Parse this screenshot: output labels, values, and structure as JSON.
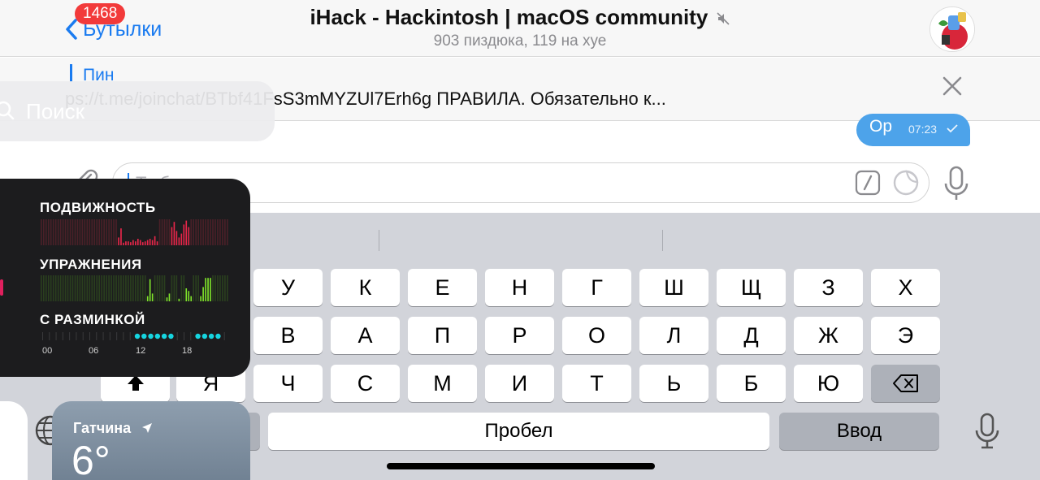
{
  "header": {
    "back_label": "Бутылки",
    "unread_badge": "1468",
    "title": "iHack - Hackintosh | macOS community",
    "subtitle": "903 пиздюка, 119 на хуе",
    "mute_icon": "speaker-muted-icon",
    "avatar_icon": "group-avatar"
  },
  "pinned": {
    "label": "Пин",
    "text": "ps://t.me/joinchat/BTbf41FsS3mMYZUl7Erh6g ПРАВИЛА. Обязательно к...",
    "close_icon": "close-icon"
  },
  "message": {
    "text": "Ор",
    "time": "07:23",
    "status_icon": "checkmark-icon"
  },
  "composer": {
    "placeholder": "Т...б...тут...",
    "attach_icon": "paperclip-icon",
    "command_icon": "slash-command-icon",
    "sticker_icon": "sticker-icon",
    "mic_icon": "microphone-icon"
  },
  "keyboard": {
    "row1": [
      "У",
      "К",
      "Е",
      "Н",
      "Г",
      "Ш",
      "Щ",
      "З",
      "Х"
    ],
    "row2": [
      "В",
      "А",
      "П",
      "Р",
      "О",
      "Л",
      "Д",
      "Ж",
      "Э"
    ],
    "row3": [
      "Я",
      "Ч",
      "С",
      "М",
      "И",
      "Т",
      "Ь",
      "Б",
      "Ю"
    ],
    "space_label": "Пробел",
    "return_label": "Ввод",
    "shift_icon": "shift-icon",
    "backspace_icon": "backspace-icon",
    "globe_icon": "globe-icon",
    "dictation_icon": "microphone-icon"
  },
  "search_overlay": {
    "label": "Поиск",
    "icon": "search-icon"
  },
  "activity": {
    "move_label": "ПОДВИЖНОСТЬ",
    "exercise_label": "УПРАЖНЕНИЯ",
    "stand_label": "С РАЗМИНКОЙ",
    "ticks": [
      "00",
      "06",
      "12",
      "18"
    ],
    "colors": {
      "move": "#e9264a",
      "exercise": "#7fe52a",
      "stand": "#16d5e0"
    },
    "move_bars": [
      0,
      0,
      0,
      0,
      0,
      0,
      0,
      0,
      0,
      0,
      0,
      0,
      0,
      0,
      0,
      0,
      0,
      0,
      0,
      0,
      0,
      0,
      0,
      0,
      0,
      0,
      0,
      0,
      0,
      0,
      0,
      0,
      0.3,
      0.65,
      0.1,
      0.15,
      0.15,
      0.12,
      0.2,
      0.15,
      0.25,
      0.2,
      0.12,
      0.15,
      0.2,
      0.25,
      0.2,
      0.35,
      0.15,
      0,
      0,
      0,
      0,
      0,
      0.7,
      0.9,
      0.55,
      0.3,
      0.45,
      0.8,
      0.95,
      0.7,
      0,
      0,
      0,
      0,
      0,
      0,
      0,
      0,
      0,
      0,
      0,
      0,
      0,
      0,
      0,
      0
    ],
    "exercise_bars": [
      0,
      0,
      0,
      0,
      0,
      0,
      0,
      0,
      0,
      0,
      0,
      0,
      0,
      0,
      0,
      0,
      0,
      0,
      0,
      0,
      0,
      0,
      0,
      0,
      0,
      0,
      0,
      0,
      0,
      0,
      0,
      0,
      0,
      0,
      0,
      0,
      0,
      0,
      0,
      0,
      0,
      0,
      0,
      0,
      0.2,
      0.85,
      0.3,
      0,
      0,
      0,
      0,
      0,
      0.15,
      0.3,
      0,
      0,
      0,
      0.1,
      0,
      0,
      0.5,
      0.4,
      0.2,
      0,
      0,
      0,
      0.2,
      0.55,
      0.9,
      0.9,
      0.9,
      0,
      0,
      0,
      0,
      0,
      0,
      0
    ],
    "stand_hours": [
      0,
      0,
      0,
      0,
      0,
      0,
      0,
      0,
      0,
      0,
      0,
      0,
      0,
      0,
      1,
      1,
      1,
      1,
      1,
      1,
      0,
      0,
      0,
      1,
      1,
      1,
      1,
      0
    ]
  },
  "weather": {
    "city": "Гатчина",
    "temperature": "6°",
    "location_icon": "location-arrow-icon"
  }
}
